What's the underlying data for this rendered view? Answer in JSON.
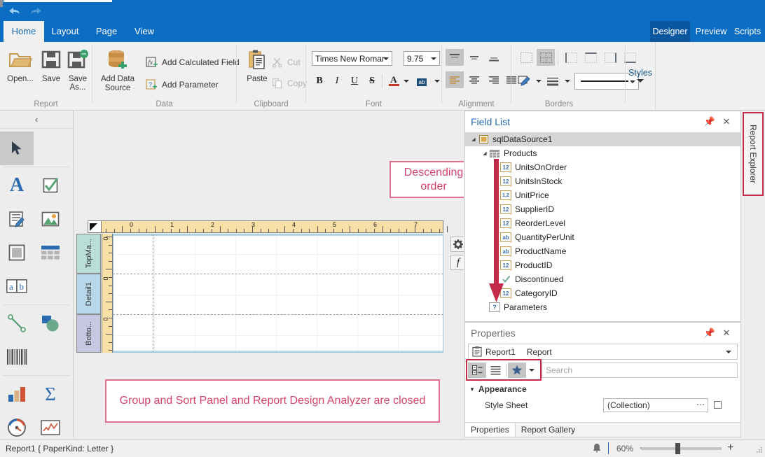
{
  "titlebar": {
    "undo_icon": "undo-arrow-icon",
    "redo_icon": "redo-arrow-icon"
  },
  "ribbon": {
    "tabs": [
      {
        "label": "Home",
        "active": true
      },
      {
        "label": "Layout",
        "active": false
      },
      {
        "label": "Page",
        "active": false
      },
      {
        "label": "View",
        "active": false
      }
    ],
    "right_tabs": [
      {
        "label": "Designer",
        "active": true
      },
      {
        "label": "Preview",
        "active": false
      },
      {
        "label": "Scripts",
        "active": false
      }
    ],
    "groups": [
      {
        "label": "Report"
      },
      {
        "label": "Data"
      },
      {
        "label": "Clipboard"
      },
      {
        "label": "Font"
      },
      {
        "label": "Alignment"
      },
      {
        "label": "Borders"
      }
    ],
    "report_group": {
      "open_label": "Open...",
      "save_label": "Save",
      "save_as_label": "Save As..."
    },
    "data_group": {
      "add_data_source_label": "Add Data Source",
      "add_calculated_field_label": "Add Calculated Field",
      "add_parameter_label": "Add Parameter"
    },
    "clipboard_group": {
      "paste_label": "Paste",
      "cut_label": "Cut",
      "copy_label": "Copy"
    },
    "font_group": {
      "font_family_value": "Times New Romar",
      "font_size_value": "9.75",
      "bold_label": "B",
      "italic_label": "I",
      "underline_label": "U",
      "strikeout_label": "S",
      "font_color_label": "A",
      "highlight_label": "ab"
    },
    "styles_label": "Styles"
  },
  "toolbox": {
    "collapse_label": "‹",
    "items": [
      {
        "name": "pointer-tool",
        "selected": true
      },
      {
        "name": "label-tool",
        "glyph": "A"
      },
      {
        "name": "checkbox-tool"
      },
      {
        "name": "rich-text-tool"
      },
      {
        "name": "picture-box-tool"
      },
      {
        "name": "panel-tool"
      },
      {
        "name": "table-tool"
      },
      {
        "name": "character-comb-tool",
        "glyph": "a b"
      },
      {
        "name": "line-tool"
      },
      {
        "name": "shape-tool"
      },
      {
        "name": "barcode-tool"
      },
      {
        "name": "chart-tool"
      },
      {
        "name": "pivot-grid-tool",
        "glyph": "Σ"
      },
      {
        "name": "gauge-tool"
      },
      {
        "name": "sparkline-tool"
      }
    ]
  },
  "design": {
    "h_ruler_marks": [
      "1",
      "0",
      "1",
      "2",
      "3",
      "4",
      "5",
      "6",
      "7"
    ],
    "bands": [
      {
        "label": "TopMa...",
        "color": "#b9ded7"
      },
      {
        "label": "Detail1",
        "color": "#b7d7ea"
      },
      {
        "label": "Botto...",
        "color": "#c8c7e2"
      }
    ],
    "smart_tag_icon": "gear-icon",
    "expression_icon": "fx-icon"
  },
  "callouts": {
    "descending_order": "Descending order",
    "panels_closed": "Group and Sort Panel and Report Design Analyzer are closed"
  },
  "field_list": {
    "title": "Field List",
    "pin_icon": "pin-icon",
    "close_icon": "close-icon",
    "nodes": [
      {
        "label": "sqlDataSource1",
        "indent": 0,
        "icon": "datasource-icon",
        "expander": "◢",
        "selected": true
      },
      {
        "label": "Products",
        "indent": 1,
        "icon": "table-icon",
        "expander": "◢",
        "selected": false
      },
      {
        "label": "UnitsOnOrder",
        "indent": 2,
        "icon": "12",
        "expander": "",
        "selected": false
      },
      {
        "label": "UnitsInStock",
        "indent": 2,
        "icon": "12",
        "expander": "",
        "selected": false
      },
      {
        "label": "UnitPrice",
        "indent": 2,
        "icon": "1,2",
        "expander": "",
        "selected": false
      },
      {
        "label": "SupplierID",
        "indent": 2,
        "icon": "12",
        "expander": "",
        "selected": false
      },
      {
        "label": "ReorderLevel",
        "indent": 2,
        "icon": "12",
        "expander": "",
        "selected": false
      },
      {
        "label": "QuantityPerUnit",
        "indent": 2,
        "icon": "ab",
        "expander": "",
        "selected": false
      },
      {
        "label": "ProductName",
        "indent": 2,
        "icon": "ab",
        "expander": "",
        "selected": false
      },
      {
        "label": "ProductID",
        "indent": 2,
        "icon": "12",
        "expander": "",
        "selected": false
      },
      {
        "label": "Discontinued",
        "indent": 2,
        "icon": "check",
        "expander": "",
        "selected": false
      },
      {
        "label": "CategoryID",
        "indent": 2,
        "icon": "12",
        "expander": "",
        "selected": false
      },
      {
        "label": "Parameters",
        "indent": 1,
        "icon": "?",
        "expander": "",
        "selected": false
      }
    ]
  },
  "properties": {
    "title": "Properties",
    "pin_icon": "pin-icon",
    "close_icon": "close-icon",
    "selected_object": "Report1",
    "selected_type": "Report",
    "search_placeholder": "Search",
    "category_label": "Appearance",
    "rows": [
      {
        "name": "Style Sheet",
        "value": "(Collection)"
      }
    ],
    "tabs": [
      {
        "label": "Properties",
        "active": true
      },
      {
        "label": "Report Gallery",
        "active": false
      }
    ]
  },
  "report_explorer": {
    "label": "Report Explorer"
  },
  "statusbar": {
    "text": "Report1 { PaperKind: Letter }",
    "bell_icon": "bell-icon",
    "zoom_value": "60%",
    "zoom_out_label": "−",
    "zoom_in_label": "+"
  },
  "colors": {
    "accent_blue": "#0b6ec4",
    "callout_pink": "#d6426b",
    "highlight_red": "#c22c49"
  }
}
